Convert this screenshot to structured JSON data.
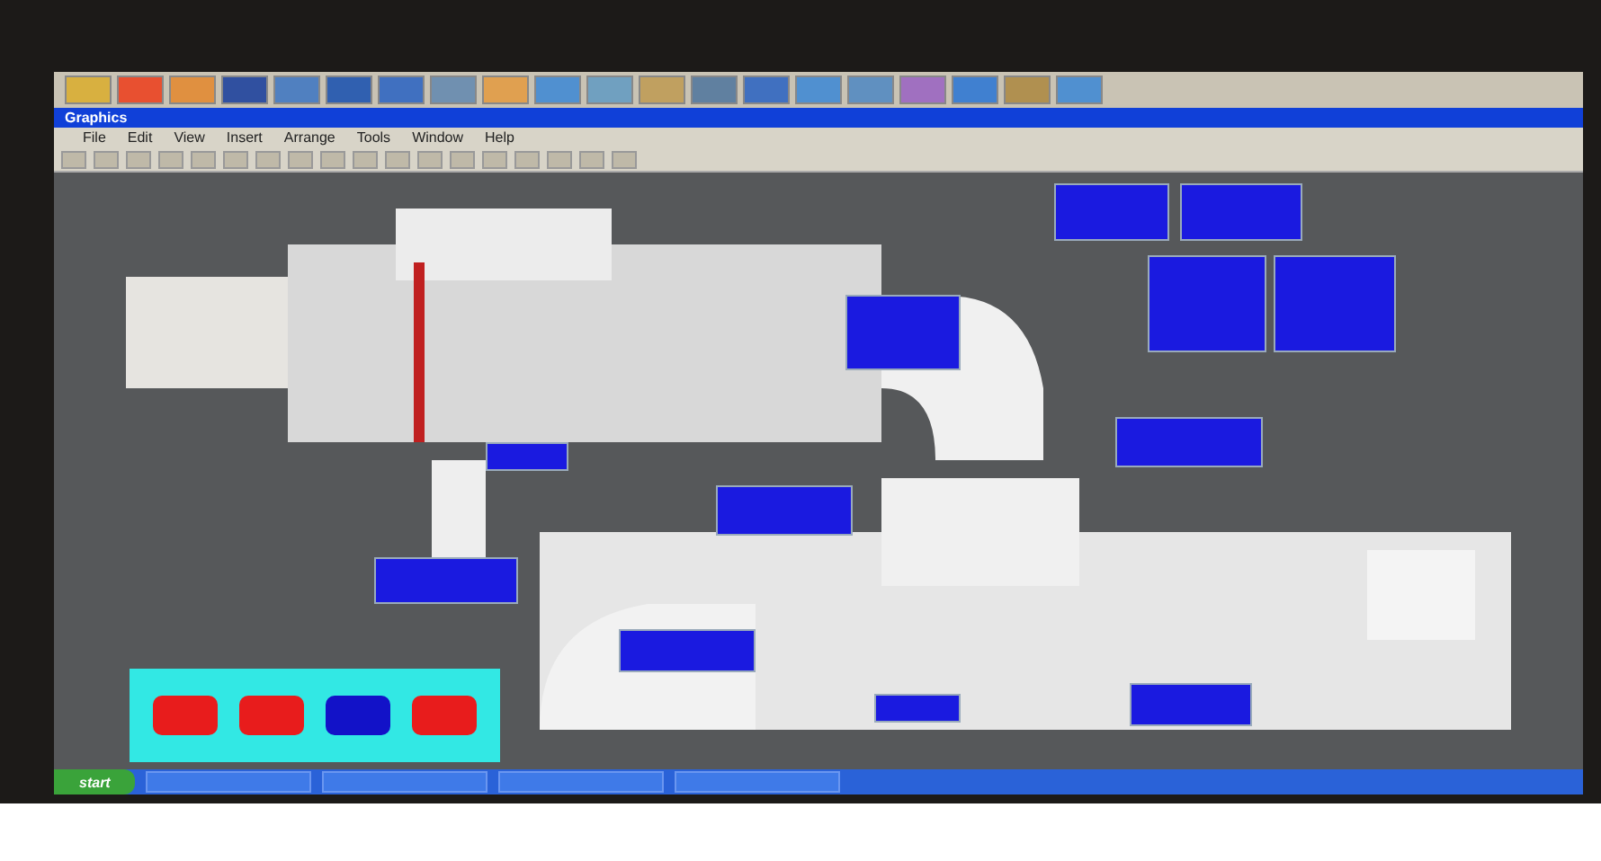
{
  "window": {
    "title": "Graphics"
  },
  "menu": [
    "File",
    "Edit",
    "View",
    "Insert",
    "Arrange",
    "Tools",
    "Window",
    "Help"
  ],
  "status_buttons": [
    {
      "color": "#e81c1c"
    },
    {
      "color": "#e81c1c"
    },
    {
      "color": "#1212c8"
    },
    {
      "color": "#e81c1c"
    }
  ],
  "taskbar": {
    "start": "start"
  }
}
